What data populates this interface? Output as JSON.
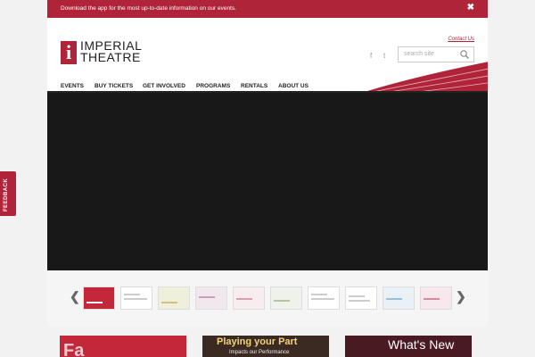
{
  "alert_bar": {
    "message": "Download the app for the most up-to-date information on our events.",
    "close_icon": "close-icon",
    "close_glyph": "✖"
  },
  "header": {
    "logo": {
      "mark": "i",
      "line1": "IMPERIAL",
      "line2": "THEATRE"
    },
    "contact_link": "Contact Us",
    "social": [
      {
        "icon": "facebook-icon",
        "glyph": "f"
      },
      {
        "icon": "twitter-icon",
        "glyph": "t"
      }
    ],
    "search": {
      "placeholder": "search site",
      "icon": "search-icon"
    }
  },
  "nav": {
    "items": [
      "EVENTS",
      "BUY TICKETS",
      "GET INVOLVED",
      "PROGRAMS",
      "RENTALS",
      "ABOUT US"
    ]
  },
  "carousel": {
    "prev_icon": "chevron-left-icon",
    "next_icon": "chevron-right-icon",
    "prev_glyph": "❮",
    "next_glyph": "❯",
    "thumbnail_count": 10
  },
  "tiles": [
    {
      "label": "",
      "color": "#c2273a"
    },
    {
      "label": "Playing your Part",
      "sublabel": "Impacts our Performance",
      "color": "#3a2a22"
    },
    {
      "label": "What's New",
      "color": "#4a1a22"
    }
  ],
  "feedback": {
    "label": "FEEDBACK"
  },
  "colors": {
    "brand": "#b0243a",
    "hero": "#181818",
    "page_bg": "#f2f2f2"
  }
}
